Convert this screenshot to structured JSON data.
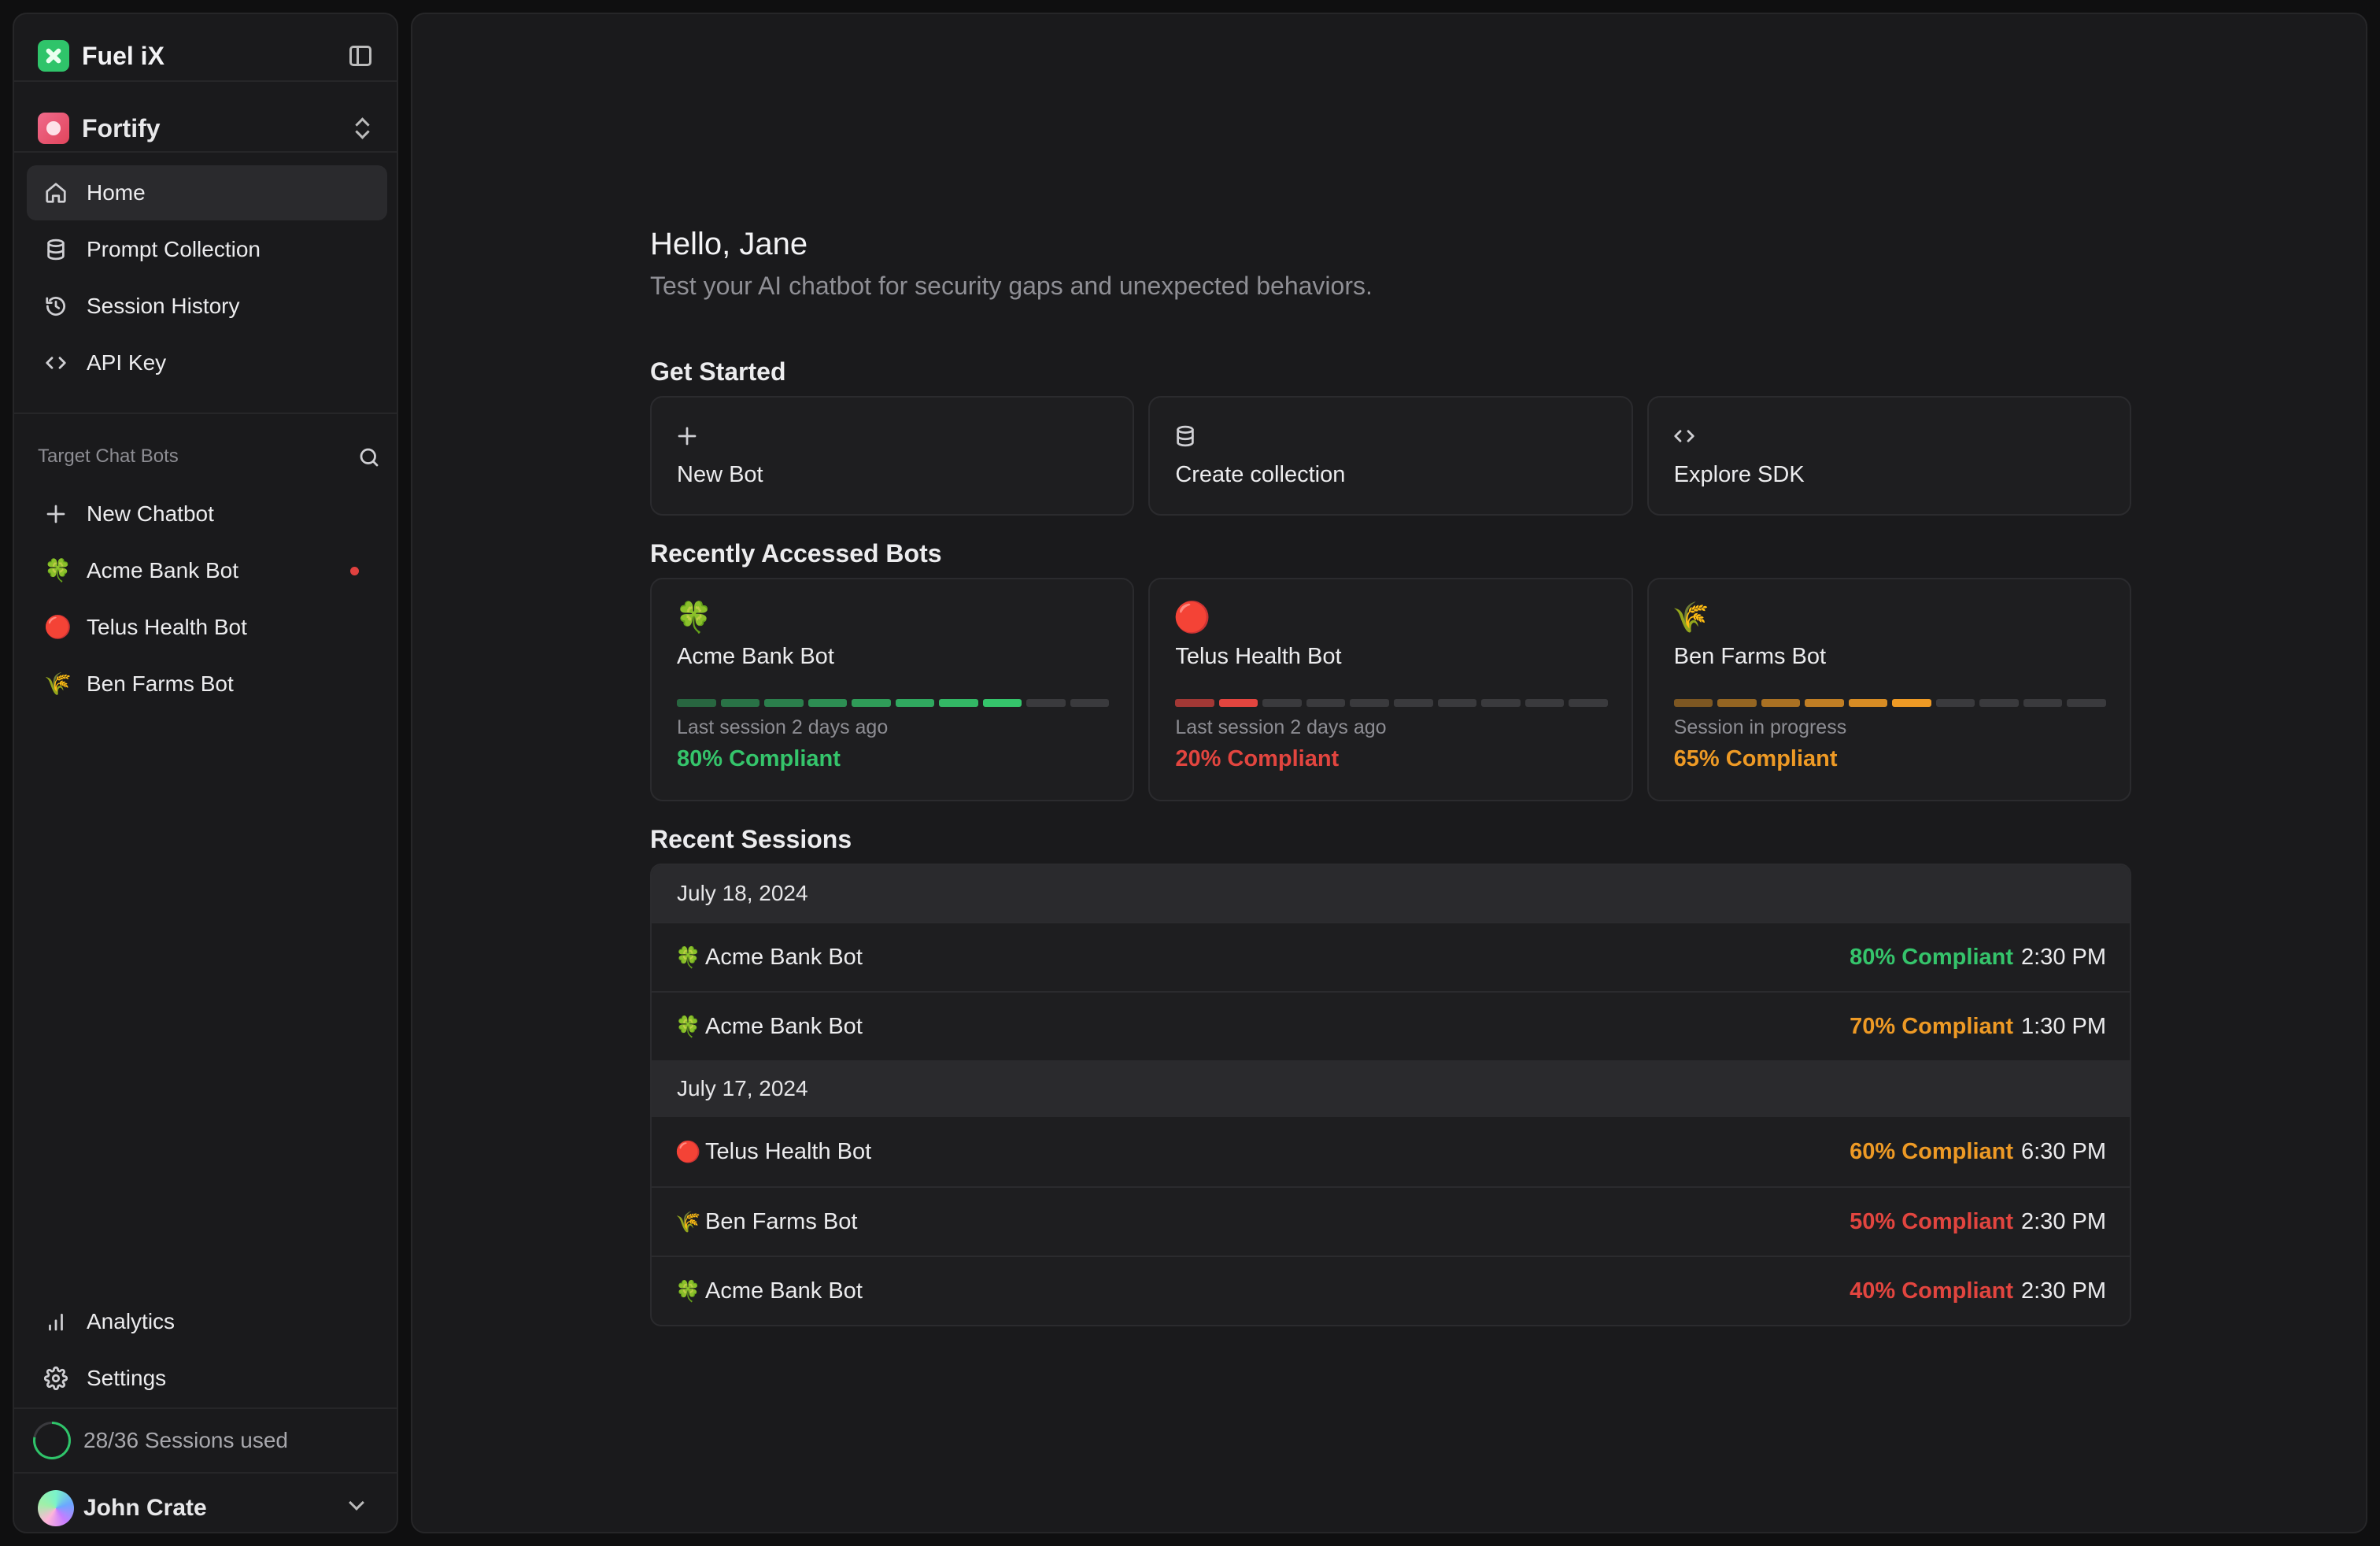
{
  "app": {
    "brand": "Fuel iX",
    "workspace": "Fortify"
  },
  "nav": [
    {
      "label": "Home",
      "icon": "home-icon",
      "active": true
    },
    {
      "label": "Prompt Collection",
      "icon": "database-icon"
    },
    {
      "label": "Session History",
      "icon": "history-icon"
    },
    {
      "label": "API Key",
      "icon": "code-icon"
    }
  ],
  "sidebar": {
    "section_label": "Target Chat Bots",
    "new_chatbot": "New Chatbot",
    "bots": [
      {
        "name": "Acme Bank Bot",
        "emoji": "🍀",
        "notify": true
      },
      {
        "name": "Telus Health Bot",
        "emoji": "🔴",
        "notify": false
      },
      {
        "name": "Ben Farms Bot",
        "emoji": "🌾",
        "notify": false
      }
    ],
    "bottom_nav": [
      {
        "label": "Analytics",
        "icon": "bar-chart-icon"
      },
      {
        "label": "Settings",
        "icon": "gear-icon"
      }
    ],
    "usage": "28/36 Sessions used",
    "usage_fraction": 0.78,
    "user": "John Crate"
  },
  "main": {
    "greeting": "Hello, Jane",
    "subtitle": "Test your AI chatbot for security gaps and unexpected behaviors.",
    "get_started": {
      "title": "Get Started",
      "actions": [
        {
          "label": "New Bot",
          "icon": "plus-icon"
        },
        {
          "label": "Create collection",
          "icon": "database-icon"
        },
        {
          "label": "Explore SDK",
          "icon": "code-icon"
        }
      ]
    },
    "recent_bots": {
      "title": "Recently Accessed Bots",
      "bots": [
        {
          "name": "Acme Bank Bot",
          "emoji": "🍀",
          "meta": "Last session 2 days ago",
          "score": "80% Compliant",
          "status": "green",
          "filled": 8,
          "segments": 10,
          "color": "#35c46b"
        },
        {
          "name": "Telus Health Bot",
          "emoji": "🔴",
          "meta": "Last session 2 days ago",
          "score": "20% Compliant",
          "status": "red",
          "filled": 2,
          "segments": 10,
          "color": "#e2453f"
        },
        {
          "name": "Ben Farms Bot",
          "emoji": "🌾",
          "meta": "Session in progress",
          "score": "65% Compliant",
          "status": "orange",
          "filled": 6,
          "segments": 10,
          "color": "#ee9a25"
        }
      ]
    },
    "recent_sessions": {
      "title": "Recent Sessions",
      "groups": [
        {
          "date": "July 18, 2024",
          "rows": [
            {
              "emoji": "🍀",
              "bot": "Acme Bank Bot",
              "score": "80% Compliant",
              "status": "green",
              "time": "2:30 PM"
            },
            {
              "emoji": "🍀",
              "bot": "Acme Bank Bot",
              "score": "70% Compliant",
              "status": "orange",
              "time": "1:30 PM"
            }
          ]
        },
        {
          "date": "July 17, 2024",
          "rows": [
            {
              "emoji": "🔴",
              "bot": "Telus Health Bot",
              "score": "60% Compliant",
              "status": "orange",
              "time": "6:30 PM"
            },
            {
              "emoji": "🌾",
              "bot": "Ben Farms Bot",
              "score": "50% Compliant",
              "status": "red",
              "time": "2:30 PM"
            },
            {
              "emoji": "🍀",
              "bot": "Acme Bank Bot",
              "score": "40% Compliant",
              "status": "red",
              "time": "2:30 PM"
            }
          ]
        }
      ]
    }
  }
}
